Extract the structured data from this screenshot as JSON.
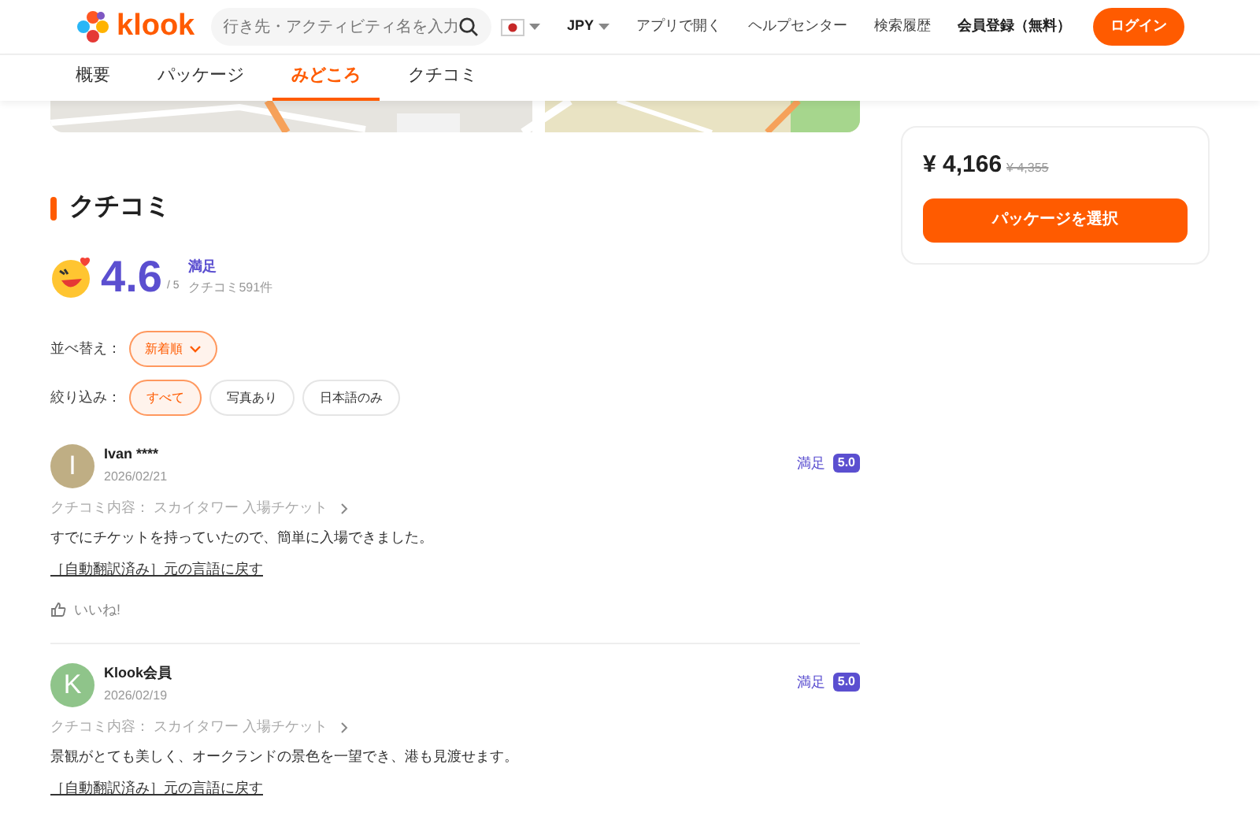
{
  "header": {
    "logo": "klook",
    "search": {
      "placeholder": "行き先・アクティビティ名を入力"
    },
    "currency": "JPY",
    "links": [
      "アプリで開く",
      "ヘルプセンター",
      "検索履歴"
    ],
    "signup": "会員登録（無料）",
    "login": "ログイン"
  },
  "tabs": [
    {
      "label": "概要",
      "selected": false
    },
    {
      "label": "パッケージ",
      "selected": false
    },
    {
      "label": "みどころ",
      "selected": true
    },
    {
      "label": "クチコミ",
      "selected": false
    }
  ],
  "reviews_section": {
    "title": "クチコミ",
    "rating": "4.6",
    "out_of": "/ 5",
    "rating_label": "満足",
    "count": "クチコミ591件",
    "sort": {
      "label": "並べ替え：",
      "value": "新着順"
    },
    "filter": {
      "label": "絞り込み：",
      "options": [
        {
          "label": "すべて",
          "selected": true
        },
        {
          "label": "写真あり",
          "selected": false
        },
        {
          "label": "日本語のみ",
          "selected": false
        }
      ]
    },
    "reviews": [
      {
        "initial": "I",
        "color": "#bfae84",
        "name": "Ivan ****",
        "date": "2026/02/21",
        "rating_label": "満足",
        "score": "5.0",
        "item": "クチコミ内容： スカイタワー 入場チケット",
        "text": "すでにチケットを持っていたので、簡単に入場できました。",
        "translation_link": "［自動翻訳済み］元の言語に戻す",
        "like": "いいね!"
      },
      {
        "initial": "K",
        "color": "#8fc48a",
        "name": "Klook会員",
        "date": "2026/02/19",
        "rating_label": "満足",
        "score": "5.0",
        "item": "クチコミ内容： スカイタワー 入場チケット",
        "text": "景観がとても美しく、オークランドの景色を一望でき、港も見渡せます。",
        "translation_link": "［自動翻訳済み］元の言語に戻す"
      }
    ]
  },
  "booking": {
    "price": "¥ 4,166",
    "original_price": "¥ 4,355",
    "button": "パッケージを選択"
  }
}
